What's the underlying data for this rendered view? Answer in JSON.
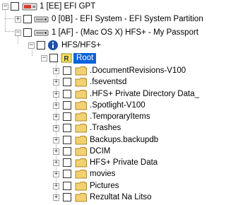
{
  "tree": {
    "items": [
      {
        "label": "1 [EE] EFI GPT",
        "icon": "hard-drive-red-icon",
        "expander": "minus"
      },
      {
        "label": "0 [0B] - EFI System - EFI System Partition",
        "icon": "disk-partition-icon",
        "expander": "plus"
      },
      {
        "label": "1 [AF] - (Mac OS X) HFS+ - My Passport",
        "icon": "disk-partition-icon",
        "expander": "minus"
      },
      {
        "label": "HFS/HFS+",
        "icon": "info-circle-icon",
        "expander": "minus"
      },
      {
        "label": "Root",
        "icon": "root-folder-icon",
        "expander": "minus",
        "selected": true
      },
      {
        "label": ".DocumentRevisions-V100",
        "icon": "folder-icon",
        "expander": "plus"
      },
      {
        "label": ".fseventsd",
        "icon": "folder-icon",
        "expander": "plus"
      },
      {
        "label": ".HFS+ Private Directory Data_",
        "icon": "folder-icon",
        "expander": "plus"
      },
      {
        "label": ".Spotlight-V100",
        "icon": "folder-icon",
        "expander": "plus"
      },
      {
        "label": ".TemporaryItems",
        "icon": "folder-icon",
        "expander": "plus"
      },
      {
        "label": ".Trashes",
        "icon": "folder-icon",
        "expander": "plus"
      },
      {
        "label": "Backups.backupdb",
        "icon": "folder-icon",
        "expander": "plus"
      },
      {
        "label": "DCIM",
        "icon": "folder-icon",
        "expander": "plus"
      },
      {
        "label": "HFS+ Private Data",
        "icon": "folder-icon",
        "expander": "plus"
      },
      {
        "label": "movies",
        "icon": "folder-icon",
        "expander": "plus"
      },
      {
        "label": "Pictures",
        "icon": "folder-icon",
        "expander": "plus"
      },
      {
        "label": "Rezultat Na Litso",
        "icon": "folder-icon",
        "expander": "plus"
      }
    ],
    "expander_glyphs": {
      "plus": "+",
      "minus": "−"
    },
    "root_badge": "R",
    "colors": {
      "selection": "#0a64d8",
      "folder": "#f2d170",
      "root_badge": "#f7e25b",
      "drive_red": "#d63b2f",
      "info_circle": "#1f4fa8"
    }
  }
}
